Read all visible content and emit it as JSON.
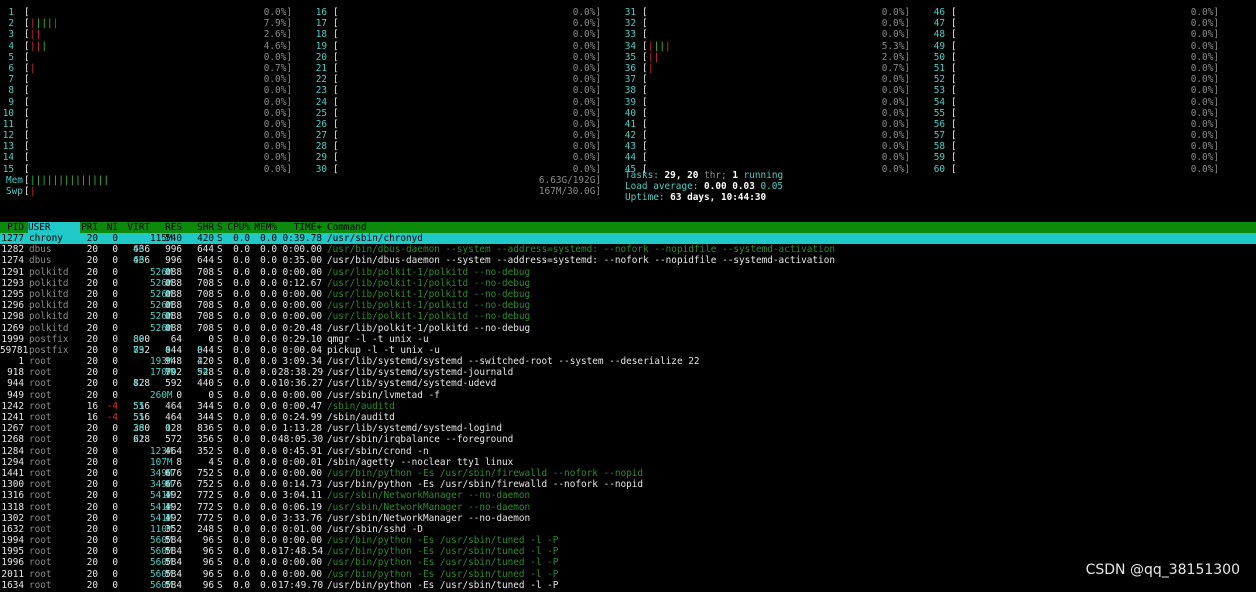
{
  "cpu_meters": [
    [
      [
        "1",
        "",
        0,
        "0.0%]"
      ],
      [
        "2",
        "rg",
        5,
        "7.9%]"
      ],
      [
        "3",
        "rr",
        2,
        "2.6%]"
      ],
      [
        "4",
        "rr",
        3,
        "4.6%]"
      ],
      [
        "5",
        "",
        0,
        "0.0%]"
      ],
      [
        "6",
        "r",
        1,
        "0.7%]"
      ],
      [
        "7",
        "",
        0,
        "0.0%]"
      ],
      [
        "8",
        "",
        0,
        "0.0%]"
      ],
      [
        "9",
        "",
        0,
        "0.0%]"
      ],
      [
        "10",
        "",
        0,
        "0.0%]"
      ],
      [
        "11",
        "",
        0,
        "0.0%]"
      ],
      [
        "12",
        "",
        0,
        "0.0%]"
      ],
      [
        "13",
        "",
        0,
        "0.0%]"
      ],
      [
        "14",
        "",
        0,
        "0.0%]"
      ],
      [
        "15",
        "",
        0,
        "0.0%]"
      ]
    ],
    [
      [
        "16",
        "",
        0,
        "0.0%]"
      ],
      [
        "17",
        "",
        0,
        "0.0%]"
      ],
      [
        "18",
        "",
        0,
        "0.0%]"
      ],
      [
        "19",
        "",
        0,
        "0.0%]"
      ],
      [
        "20",
        "",
        0,
        "0.0%]"
      ],
      [
        "21",
        "",
        0,
        "0.0%]"
      ],
      [
        "22",
        "",
        0,
        "0.0%]"
      ],
      [
        "23",
        "",
        0,
        "0.0%]"
      ],
      [
        "24",
        "",
        0,
        "0.0%]"
      ],
      [
        "25",
        "",
        0,
        "0.0%]"
      ],
      [
        "26",
        "",
        0,
        "0.0%]"
      ],
      [
        "27",
        "",
        0,
        "0.0%]"
      ],
      [
        "28",
        "",
        0,
        "0.0%]"
      ],
      [
        "29",
        "",
        0,
        "0.0%]"
      ],
      [
        "30",
        "",
        0,
        "0.0%]"
      ]
    ],
    [
      [
        "31",
        "",
        0,
        "0.0%]"
      ],
      [
        "32",
        "",
        0,
        "0.0%]"
      ],
      [
        "33",
        "",
        0,
        "0.0%]"
      ],
      [
        "34",
        "rg",
        4,
        "5.3%]"
      ],
      [
        "35",
        "rr",
        2,
        "2.0%]"
      ],
      [
        "36",
        "r",
        1,
        "0.7%]"
      ],
      [
        "37",
        "",
        0,
        "0.0%]"
      ],
      [
        "38",
        "",
        0,
        "0.0%]"
      ],
      [
        "39",
        "",
        0,
        "0.0%]"
      ],
      [
        "40",
        "",
        0,
        "0.0%]"
      ],
      [
        "41",
        "",
        0,
        "0.0%]"
      ],
      [
        "42",
        "",
        0,
        "0.0%]"
      ],
      [
        "43",
        "",
        0,
        "0.0%]"
      ],
      [
        "44",
        "",
        0,
        "0.0%]"
      ],
      [
        "45",
        "",
        0,
        "0.0%]"
      ]
    ],
    [
      [
        "46",
        "",
        0,
        "0.0%]"
      ],
      [
        "47",
        "",
        0,
        "0.0%]"
      ],
      [
        "48",
        "",
        0,
        "0.0%]"
      ],
      [
        "49",
        "",
        0,
        "0.0%]"
      ],
      [
        "50",
        "",
        0,
        "0.0%]"
      ],
      [
        "51",
        "",
        0,
        "0.0%]"
      ],
      [
        "52",
        "",
        0,
        "0.0%]"
      ],
      [
        "53",
        "",
        0,
        "0.0%]"
      ],
      [
        "54",
        "",
        0,
        "0.0%]"
      ],
      [
        "55",
        "",
        0,
        "0.0%]"
      ],
      [
        "56",
        "",
        0,
        "0.0%]"
      ],
      [
        "57",
        "",
        0,
        "0.0%]"
      ],
      [
        "58",
        "",
        0,
        "0.0%]"
      ],
      [
        "59",
        "",
        0,
        "0.0%]"
      ],
      [
        "60",
        "",
        0,
        "0.0%]"
      ]
    ]
  ],
  "mem": {
    "label": "Mem",
    "bars": "||||||||||||||",
    "value": "6.63G/192G]"
  },
  "swp": {
    "label": "Swp",
    "bars": "|",
    "value": "167M/30.0G]"
  },
  "tasks": {
    "label": "Tasks:",
    "count": "29,",
    "thr": "20",
    "thr_label": "thr;",
    "running": "1",
    "running_label": "running",
    "load_label": "Load average:",
    "load1": "0.00",
    "load5": "0.03",
    "load15": "0.05",
    "uptime_label": "Uptime:",
    "uptime": "63 days, 10:44:30"
  },
  "header": {
    "pid": "PID",
    "user": "USER",
    "pri": "PRI",
    "ni": "NI",
    "virt": "VIRT",
    "res": "RES",
    "shr": "SHR",
    "s": "S",
    "cpu": "CPU%",
    "mem": "MEM%",
    "time": "TIME+",
    "command": "Command"
  },
  "processes": [
    [
      "1277",
      "chrony",
      "20",
      "0",
      "115M",
      "540",
      "420",
      "S",
      "0.0",
      "0.0",
      "0:39.78",
      "/usr/sbin/chronyd",
      "w"
    ],
    [
      "1282",
      "dbus",
      "20",
      "0",
      "66436",
      "996",
      "644",
      "S",
      "0.0",
      "0.0",
      "0:00.00",
      "/usr/bin/dbus-daemon --system --address=systemd: --nofork --nopidfile --systemd-activation",
      "g"
    ],
    [
      "1274",
      "dbus",
      "20",
      "0",
      "66436",
      "996",
      "644",
      "S",
      "0.0",
      "0.0",
      "0:35.00",
      "/usr/bin/dbus-daemon --system --address=systemd: --nofork --nopidfile --systemd-activation",
      "w"
    ],
    [
      "1291",
      "polkitd",
      "20",
      "0",
      "526M",
      "1088",
      "708",
      "S",
      "0.0",
      "0.0",
      "0:00.00",
      "/usr/lib/polkit-1/polkitd --no-debug",
      "g"
    ],
    [
      "1293",
      "polkitd",
      "20",
      "0",
      "526M",
      "1088",
      "708",
      "S",
      "0.0",
      "0.0",
      "0:12.67",
      "/usr/lib/polkit-1/polkitd --no-debug",
      "g"
    ],
    [
      "1295",
      "polkitd",
      "20",
      "0",
      "526M",
      "1088",
      "708",
      "S",
      "0.0",
      "0.0",
      "0:00.00",
      "/usr/lib/polkit-1/polkitd --no-debug",
      "g"
    ],
    [
      "1296",
      "polkitd",
      "20",
      "0",
      "526M",
      "1088",
      "708",
      "S",
      "0.0",
      "0.0",
      "0:00.00",
      "/usr/lib/polkit-1/polkitd --no-debug",
      "g"
    ],
    [
      "1298",
      "polkitd",
      "20",
      "0",
      "526M",
      "1088",
      "708",
      "S",
      "0.0",
      "0.0",
      "0:00.00",
      "/usr/lib/polkit-1/polkitd --no-debug",
      "g"
    ],
    [
      "1269",
      "polkitd",
      "20",
      "0",
      "526M",
      "1088",
      "708",
      "S",
      "0.0",
      "0.0",
      "0:20.48",
      "/usr/lib/polkit-1/polkitd --no-debug",
      "w"
    ],
    [
      "1999",
      "postfix",
      "20",
      "0",
      "89800",
      "64",
      "0",
      "S",
      "0.0",
      "0.0",
      "0:29.10",
      "qmgr -l -t unix -u",
      "w"
    ],
    [
      "59781",
      "postfix",
      "20",
      "0",
      "89732",
      "4044",
      "3044",
      "S",
      "0.0",
      "0.0",
      "0:00.04",
      "pickup -l -t unix -u",
      "w"
    ],
    [
      "1",
      "root",
      "20",
      "0",
      "193M",
      "3948",
      "2420",
      "S",
      "0.0",
      "0.0",
      "3:09.34",
      "/usr/lib/systemd/systemd --switched-root --system --deserialize 22",
      "w"
    ],
    [
      "918",
      "root",
      "20",
      "0",
      "170M",
      "94792",
      "94528",
      "S",
      "0.0",
      "0.0",
      "28:38.29",
      "/usr/lib/systemd/systemd-journald",
      "w"
    ],
    [
      "944",
      "root",
      "20",
      "0",
      "47828",
      "592",
      "440",
      "S",
      "0.0",
      "0.0",
      "10:36.27",
      "/usr/lib/systemd/systemd-udevd",
      "w"
    ],
    [
      "949",
      "root",
      "20",
      "0",
      "260M",
      "0",
      "0",
      "S",
      "0.0",
      "0.0",
      "0:00.00",
      "/usr/sbin/lvmetad -f",
      "w"
    ],
    [
      "1242",
      "root",
      "16",
      "-4",
      "55516",
      "464",
      "344",
      "S",
      "0.0",
      "0.0",
      "0:00.47",
      "/sbin/auditd",
      "g"
    ],
    [
      "1241",
      "root",
      "16",
      "-4",
      "55516",
      "464",
      "344",
      "S",
      "0.0",
      "0.0",
      "0:24.99",
      "/sbin/auditd",
      "w"
    ],
    [
      "1267",
      "root",
      "20",
      "0",
      "26380",
      "1028",
      "836",
      "S",
      "0.0",
      "0.0",
      "1:13.28",
      "/usr/lib/systemd/systemd-logind",
      "w"
    ],
    [
      "1268",
      "root",
      "20",
      "0",
      "21628",
      "572",
      "356",
      "S",
      "0.0",
      "0.0",
      "48:05.30",
      "/usr/sbin/irqbalance --foreground",
      "w"
    ],
    [
      "1284",
      "root",
      "20",
      "0",
      "123M",
      "464",
      "352",
      "S",
      "0.0",
      "0.0",
      "0:45.91",
      "/usr/sbin/crond -n",
      "w"
    ],
    [
      "1294",
      "root",
      "20",
      "0",
      "107M",
      "8",
      "4",
      "S",
      "0.0",
      "0.0",
      "0:00.01",
      "/sbin/agetty --noclear tty1 linux",
      "w"
    ],
    [
      "1441",
      "root",
      "20",
      "0",
      "349M",
      "1676",
      "752",
      "S",
      "0.0",
      "0.0",
      "0:00.00",
      "/usr/bin/python -Es /usr/sbin/firewalld --nofork --nopid",
      "g"
    ],
    [
      "1300",
      "root",
      "20",
      "0",
      "349M",
      "1676",
      "752",
      "S",
      "0.0",
      "0.0",
      "0:14.73",
      "/usr/bin/python -Es /usr/sbin/firewalld --nofork --nopid",
      "w"
    ],
    [
      "1316",
      "root",
      "20",
      "0",
      "541M",
      "1492",
      "772",
      "S",
      "0.0",
      "0.0",
      "3:04.11",
      "/usr/sbin/NetworkManager --no-daemon",
      "g"
    ],
    [
      "1318",
      "root",
      "20",
      "0",
      "541M",
      "1492",
      "772",
      "S",
      "0.0",
      "0.0",
      "0:06.19",
      "/usr/sbin/NetworkManager --no-daemon",
      "g"
    ],
    [
      "1302",
      "root",
      "20",
      "0",
      "541M",
      "1492",
      "772",
      "S",
      "0.0",
      "0.0",
      "3:33.76",
      "/usr/sbin/NetworkManager --no-daemon",
      "w"
    ],
    [
      "1632",
      "root",
      "20",
      "0",
      "110M",
      "352",
      "248",
      "S",
      "0.0",
      "0.0",
      "0:01.00",
      "/usr/sbin/sshd -D",
      "w"
    ],
    [
      "1994",
      "root",
      "20",
      "0",
      "560M",
      "584",
      "96",
      "S",
      "0.0",
      "0.0",
      "0:00.00",
      "/usr/bin/python -Es /usr/sbin/tuned -l -P",
      "g"
    ],
    [
      "1995",
      "root",
      "20",
      "0",
      "560M",
      "584",
      "96",
      "S",
      "0.0",
      "0.0",
      "17:48.54",
      "/usr/bin/python -Es /usr/sbin/tuned -l -P",
      "g"
    ],
    [
      "1996",
      "root",
      "20",
      "0",
      "560M",
      "584",
      "96",
      "S",
      "0.0",
      "0.0",
      "0:00.00",
      "/usr/bin/python -Es /usr/sbin/tuned -l -P",
      "g"
    ],
    [
      "2011",
      "root",
      "20",
      "0",
      "560M",
      "584",
      "96",
      "S",
      "0.0",
      "0.0",
      "0:00.00",
      "/usr/bin/python -Es /usr/sbin/tuned -l -P",
      "g"
    ],
    [
      "1634",
      "root",
      "20",
      "0",
      "560M",
      "584",
      "96",
      "S",
      "0.0",
      "0.0",
      "17:49.70",
      "/usr/bin/python -Es /usr/sbin/tuned -l -P",
      "w"
    ]
  ],
  "watermark": "CSDN @qq_38151300"
}
